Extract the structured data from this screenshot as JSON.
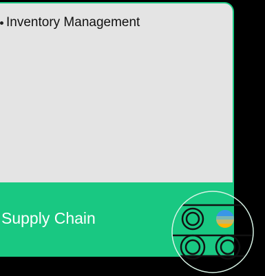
{
  "card": {
    "bullets": [
      {
        "text": "Inventory Management"
      }
    ],
    "footer_title": "Supply Chain"
  },
  "icons": {
    "badge": "supply-chain-conveyor-icon"
  },
  "colors": {
    "accent": "#19c882",
    "card_bg": "#e4e4e4",
    "page_bg": "#000000",
    "footer_text": "#ffffff",
    "bullet_text": "#111111",
    "ball_top": "#3a96e6",
    "ball_bottom": "#ffb400"
  }
}
